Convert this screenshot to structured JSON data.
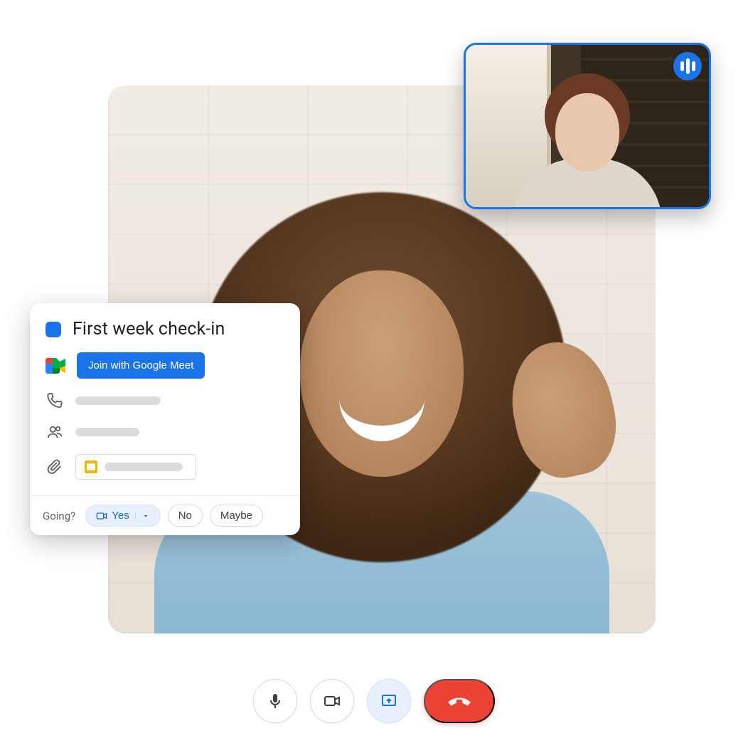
{
  "event": {
    "title": "First week check-in",
    "color": "#1a73e8",
    "join_button_label": "Join with Google Meet"
  },
  "rsvp": {
    "prompt": "Going?",
    "options": {
      "yes": "Yes",
      "no": "No",
      "maybe": "Maybe"
    },
    "selected": "yes"
  },
  "icons": {
    "meet": "google-meet-icon",
    "phone": "phone-icon",
    "people": "people-icon",
    "attachment": "attachment-icon",
    "slides": "google-slides-icon",
    "video_location": "video-location-icon",
    "caret_down": "caret-down-icon",
    "mic": "microphone-icon",
    "camera": "camera-icon",
    "present": "present-screen-icon",
    "hangup": "hang-up-icon",
    "speaking": "speaking-indicator-icon"
  },
  "controls": {
    "mic_on": true,
    "camera_on": true,
    "presenting_active": true
  },
  "colors": {
    "primary": "#1a73e8",
    "danger": "#ea4335",
    "slides_yellow": "#f4b400"
  }
}
